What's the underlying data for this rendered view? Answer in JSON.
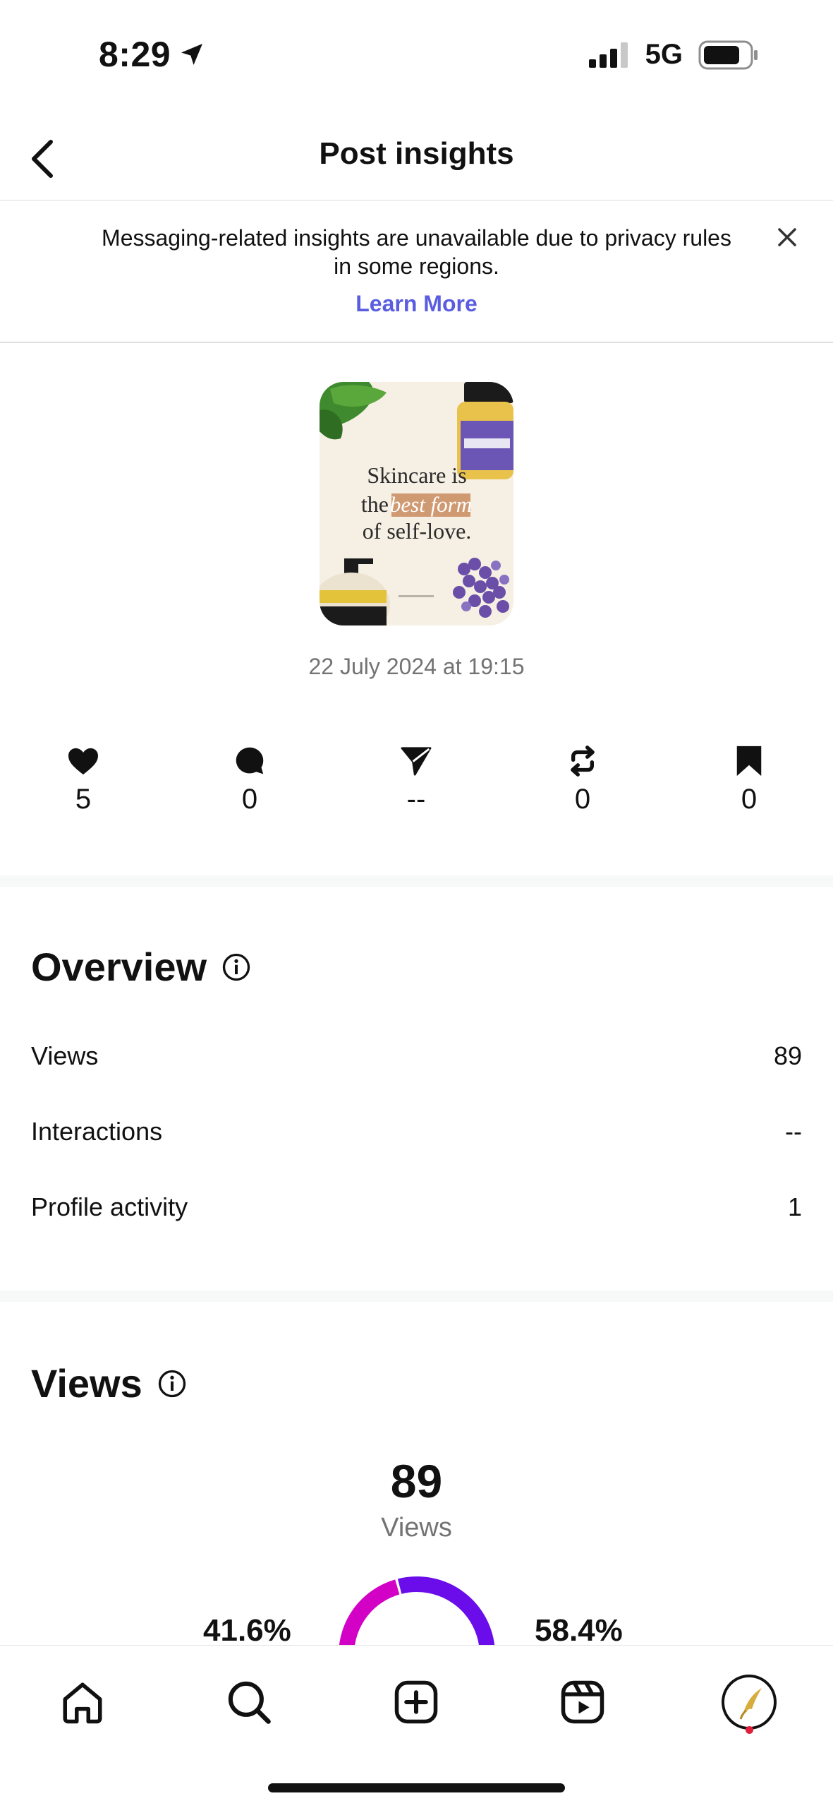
{
  "status_bar": {
    "time": "8:29",
    "network": "5G"
  },
  "header": {
    "title": "Post insights"
  },
  "notice": {
    "text": "Messaging-related insights are unavailable due to privacy rules in some regions.",
    "link": "Learn More"
  },
  "post": {
    "image_text": {
      "line1": "Skincare is",
      "line2_a": "the",
      "line2_b": "best form",
      "line3": "of self-love."
    },
    "date": "22 July 2024 at 19:15"
  },
  "metrics": [
    {
      "icon": "heart-icon",
      "value": "5"
    },
    {
      "icon": "comment-icon",
      "value": "0"
    },
    {
      "icon": "share-icon",
      "value": "--"
    },
    {
      "icon": "repost-icon",
      "value": "0"
    },
    {
      "icon": "save-icon",
      "value": "0"
    }
  ],
  "overview": {
    "title": "Overview",
    "rows": [
      {
        "label": "Views",
        "value": "89"
      },
      {
        "label": "Interactions",
        "value": "--"
      },
      {
        "label": "Profile activity",
        "value": "1"
      }
    ]
  },
  "views": {
    "title": "Views",
    "total": "89",
    "total_label": "Views",
    "left_pct": "41.6%",
    "right_pct": "58.4%",
    "left_fraction": 0.416,
    "right_fraction": 0.584,
    "left_color": "#d300c5",
    "right_color": "#6a0dea"
  },
  "tabs": [
    "home-icon",
    "search-icon",
    "create-icon",
    "reels-icon",
    "profile-avatar-icon"
  ],
  "colors": {
    "link": "#5a5ddf",
    "notification_dot": "#e0203a"
  }
}
